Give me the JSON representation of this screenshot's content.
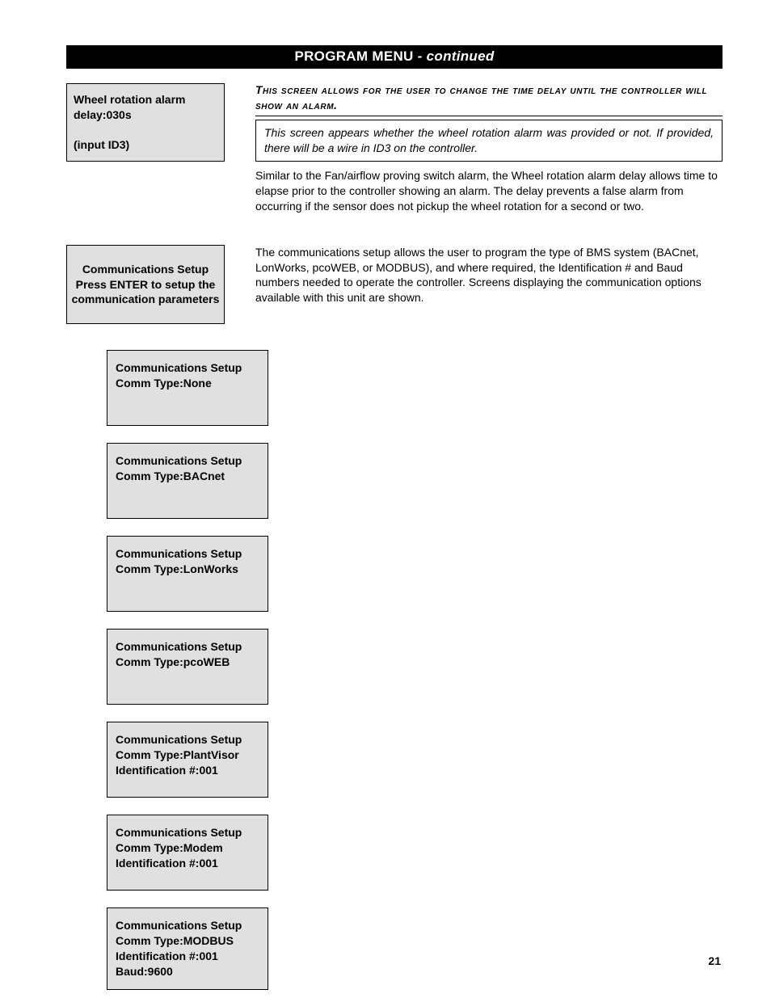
{
  "title": {
    "main": "PROGRAM MENU - ",
    "cont": "continued"
  },
  "wheel_box": {
    "line1": "Wheel rotation alarm",
    "line2": "delay:030s",
    "line3": "(input  ID3)"
  },
  "wheel_right": {
    "callout": "This screen allows for the user to change the time delay until the controller will show an alarm.",
    "note": "This screen appears whether the wheel rotation alarm was provided or not. If provided, there will be a wire in ID3 on the controller.",
    "body": "Similar to the Fan/airflow proving switch alarm, the Wheel rotation alarm delay allows time to elapse prior to the controller showing an alarm. The delay prevents a false alarm from occurring if the sensor does not pickup the wheel rotation for a second or two."
  },
  "comm_box": {
    "line1": "Communications Setup",
    "line2": "Press ENTER to setup the",
    "line3": "communication parameters"
  },
  "comm_right": {
    "body": "The communications setup allows the user to program the type of BMS system (BACnet, LonWorks, pcoWEB, or MODBUS), and where required, the Identification # and Baud numbers needed to operate the controller. Screens displaying the communication options available with this unit are shown."
  },
  "screens": [
    {
      "l1": "Communications Setup",
      "l2": "Comm Type:None",
      "l3": "",
      "l4": ""
    },
    {
      "l1": "Communications Setup",
      "l2": "Comm Type:BACnet",
      "l3": "",
      "l4": ""
    },
    {
      "l1": "Communications Setup",
      "l2": "Comm Type:LonWorks",
      "l3": "",
      "l4": ""
    },
    {
      "l1": "Communications Setup",
      "l2": "Comm Type:pcoWEB",
      "l3": "",
      "l4": ""
    },
    {
      "l1": "Communications Setup",
      "l2": "Comm Type:PlantVisor",
      "l3": "Identification #:001",
      "l4": ""
    },
    {
      "l1": "Communications Setup",
      "l2": "Comm Type:Modem",
      "l3": "Identification #:001",
      "l4": ""
    },
    {
      "l1": "Communications Setup",
      "l2": "Comm Type:MODBUS",
      "l3": "Identification #:001",
      "l4": "Baud:9600"
    }
  ],
  "page_number": "21"
}
